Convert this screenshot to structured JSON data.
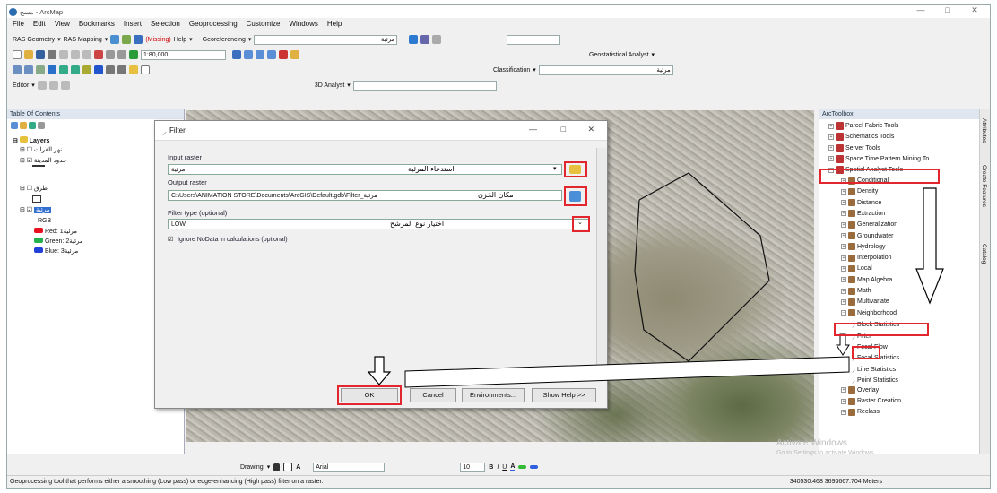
{
  "window": {
    "title": "مسح - ArcMap",
    "controls": [
      "—",
      "□",
      "✕"
    ]
  },
  "menu": [
    "File",
    "Edit",
    "View",
    "Bookmarks",
    "Insert",
    "Selection",
    "Geoprocessing",
    "Customize",
    "Windows",
    "Help"
  ],
  "toolbar1": {
    "ras_geometry": "RAS Geometry",
    "ras_mapping": "RAS Mapping",
    "missing": "(Missing)",
    "help": "Help",
    "georef": "Georeferencing",
    "layer": "مرئية"
  },
  "toolbar2": {
    "scale": "1:80,000",
    "geostat": "Geostatistical Analyst"
  },
  "toolbar3": {
    "classification": "Classification",
    "layer": "مرئية"
  },
  "toolbar4": {
    "editor": "Editor",
    "analyst3d": "3D Analyst"
  },
  "toc": {
    "title": "Table Of Contents",
    "layers_label": "Layers",
    "items": [
      "نهر الفرات",
      "حدود المدينة",
      "طرق",
      "مرئية"
    ],
    "rgb": "RGB",
    "bands": [
      {
        "label": "Red:",
        "band": "مرئية1",
        "color": "#e8101e"
      },
      {
        "label": "Green:",
        "band": "مرئية2",
        "color": "#22b14c"
      },
      {
        "label": "Blue:",
        "band": "مرئية3",
        "color": "#2040d8"
      }
    ]
  },
  "dialog": {
    "title": "Filter",
    "input_label": "Input raster",
    "input_value": "مرئية",
    "input_note": "استدعاء المرئية",
    "output_label": "Output raster",
    "output_value": "C:\\Users\\ANIMATION STORE\\Documents\\ArcGIS\\Default.gdb\\Filter_مرئية",
    "output_note": "مكان الخزن",
    "filter_label": "Filter type (optional)",
    "filter_value": "LOW",
    "filter_note": "اختيار نوع المرشح",
    "ignore_label": "Ignore NoData in calculations (optional)",
    "ok": "OK",
    "cancel": "Cancel",
    "env": "Environments...",
    "help": "Show Help >>"
  },
  "toolbox": {
    "title": "ArcToolbox",
    "items": [
      {
        "label": "Parcel Fabric Tools",
        "level": 1
      },
      {
        "label": "Schematics Tools",
        "level": 1
      },
      {
        "label": "Server Tools",
        "level": 1
      },
      {
        "label": "Space Time Pattern Mining To",
        "level": 1
      },
      {
        "label": "Spatial Analyst Tools",
        "level": 1
      },
      {
        "label": "Conditional",
        "level": 2
      },
      {
        "label": "Density",
        "level": 2
      },
      {
        "label": "Distance",
        "level": 2
      },
      {
        "label": "Extraction",
        "level": 2
      },
      {
        "label": "Generalization",
        "level": 2
      },
      {
        "label": "Groundwater",
        "level": 2
      },
      {
        "label": "Hydrology",
        "level": 2
      },
      {
        "label": "Interpolation",
        "level": 2
      },
      {
        "label": "Local",
        "level": 2
      },
      {
        "label": "Map Algebra",
        "level": 2
      },
      {
        "label": "Math",
        "level": 2
      },
      {
        "label": "Multivariate",
        "level": 2
      },
      {
        "label": "Neighborhood",
        "level": 2
      },
      {
        "label": "Block Statistics",
        "level": 3
      },
      {
        "label": "Filter",
        "level": 3
      },
      {
        "label": "Focal Flow",
        "level": 3
      },
      {
        "label": "Focal Statistics",
        "level": 3
      },
      {
        "label": "Line Statistics",
        "level": 3
      },
      {
        "label": "Point Statistics",
        "level": 3
      },
      {
        "label": "Overlay",
        "level": 2
      },
      {
        "label": "Raster Creation",
        "level": 2
      },
      {
        "label": "Reclass",
        "level": 2
      }
    ]
  },
  "side_tabs": [
    "Attributes",
    "Create Features",
    "Catalog"
  ],
  "drawing": {
    "label": "Drawing",
    "font": "Arial",
    "size": "10"
  },
  "watermark": {
    "line1": "Activate Windows",
    "line2": "Go to Settings to activate Windows."
  },
  "status": {
    "text": "Geoprocessing tool that performs either a smoothing (Low pass) or edge-enhancing (High pass) filter on a raster.",
    "coords": "340530.468  3693667.704 Meters"
  }
}
